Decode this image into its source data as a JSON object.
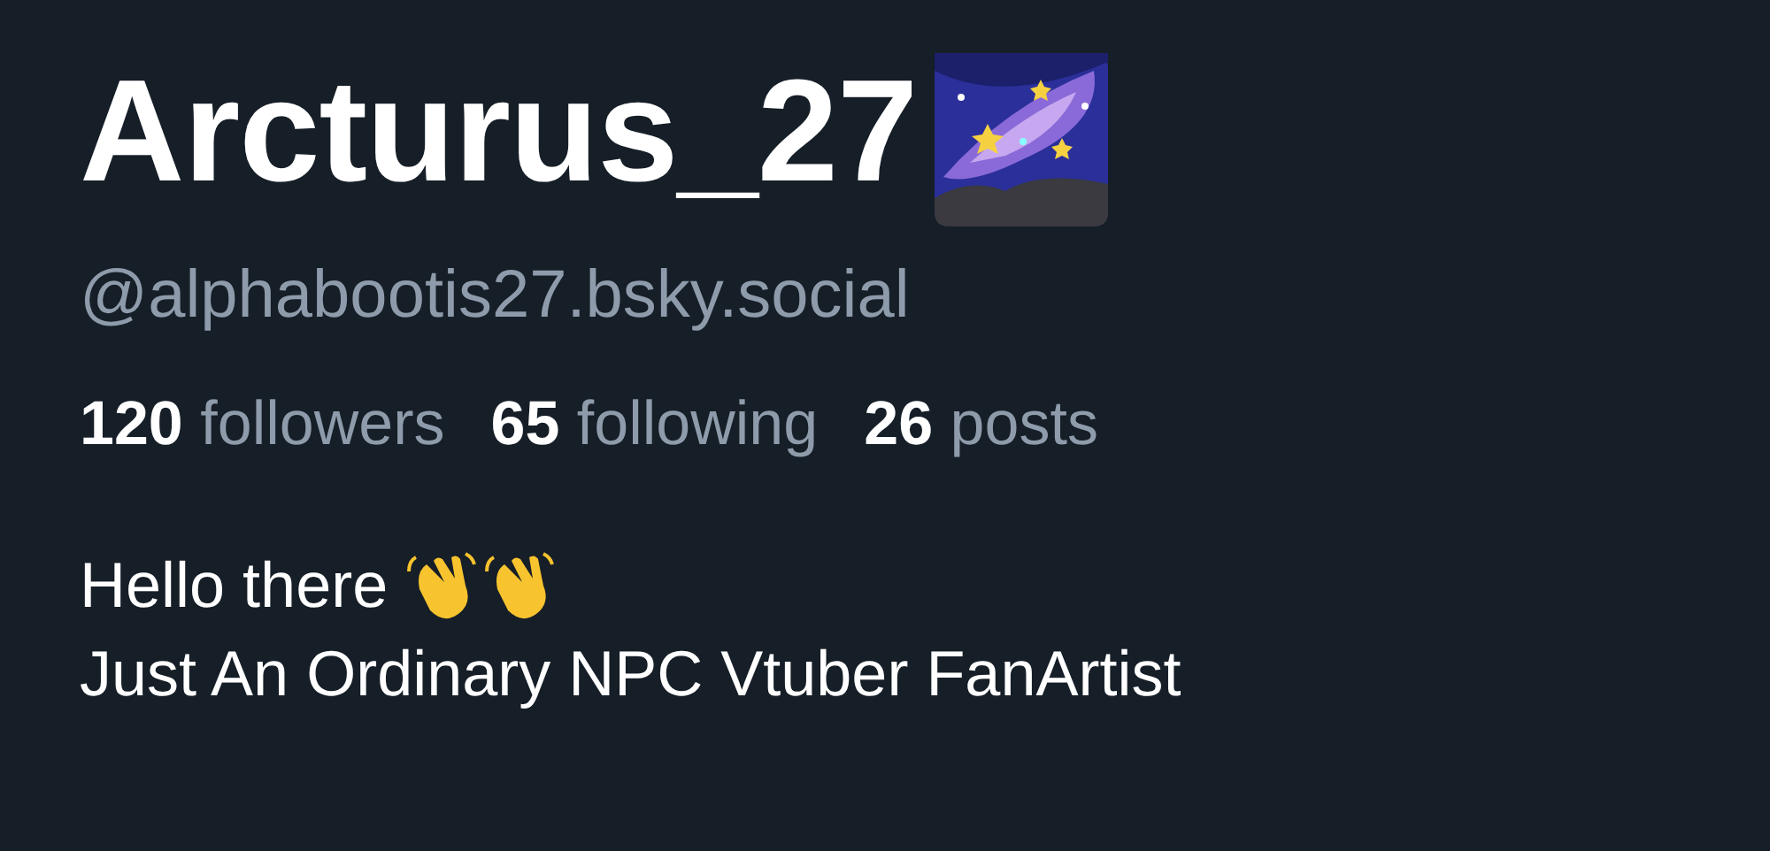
{
  "profile": {
    "display_name": "Arcturus_27",
    "handle": "@alphabootis27.bsky.social"
  },
  "stats": [
    {
      "count": "120",
      "label": "followers"
    },
    {
      "count": "65",
      "label": "following"
    },
    {
      "count": "26",
      "label": "posts"
    }
  ],
  "bio": {
    "line_1": "Hello there",
    "line_2": "Just An Ordinary NPC Vtuber FanArtist"
  }
}
